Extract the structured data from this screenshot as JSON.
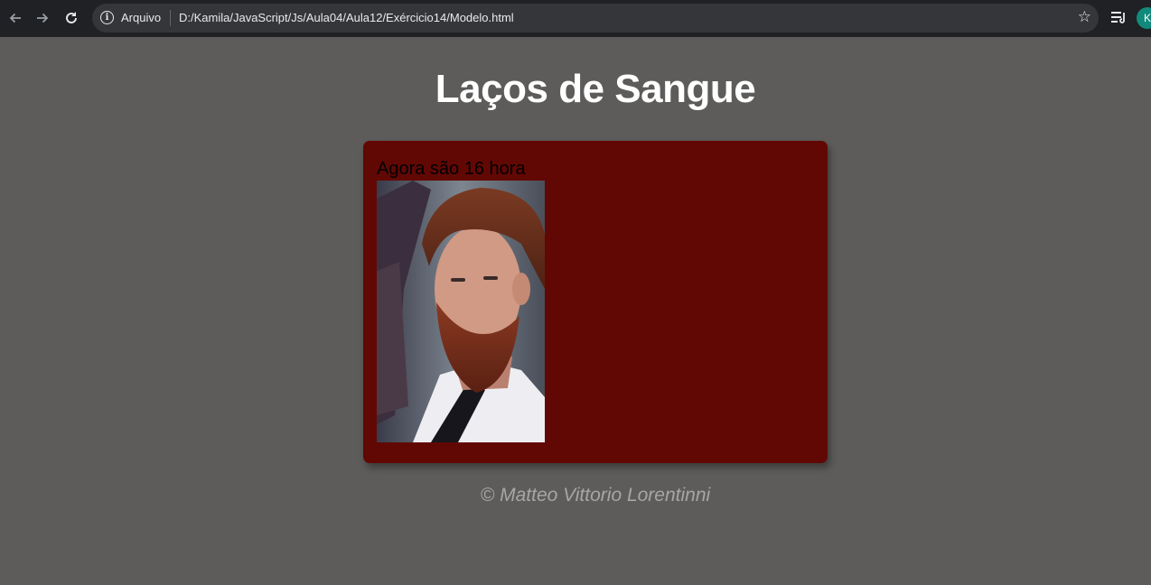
{
  "browser": {
    "security_label": "Arquivo",
    "url": "D:/Kamila/JavaScript/Js/Aula04/Aula12/Exércicio14/Modelo.html",
    "profile_initial": "K",
    "icons": {
      "back": "arrow-left-icon",
      "forward": "arrow-right-icon",
      "reload": "reload-icon",
      "info": "info-icon",
      "bookmark": "star-icon",
      "reading_list": "reading-list-icon"
    }
  },
  "page": {
    "title": "Laços de Sangue",
    "message": "Agora são 16 hora",
    "footer": "© Matteo Vittorio Lorentinni"
  },
  "colors": {
    "page_background": "#5d5c5a",
    "card_background": "#620804",
    "toolbar_background": "#202124",
    "footer_text": "#a6a6a4"
  }
}
